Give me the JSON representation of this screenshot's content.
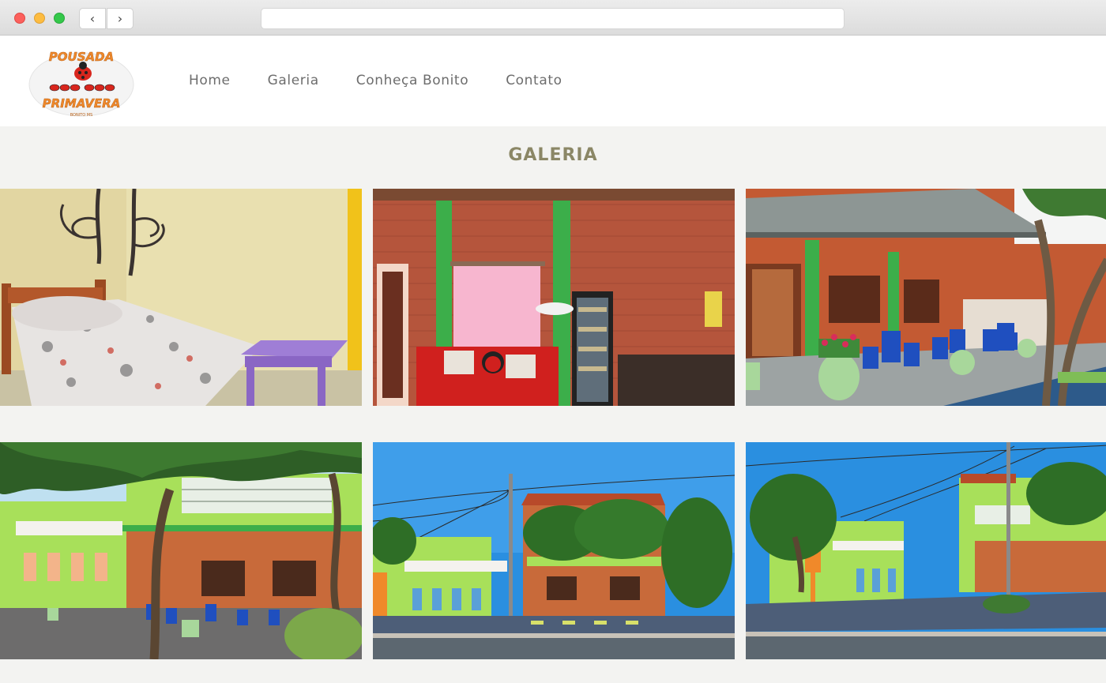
{
  "nav": {
    "back_glyph": "‹",
    "forward_glyph": "›"
  },
  "logo": {
    "line1": "POUSADA",
    "line2": "PRIMAVERA",
    "line3": "BONITO MS"
  },
  "menu": [
    {
      "label": "Home"
    },
    {
      "label": "Galeria"
    },
    {
      "label": "Conheça Bonito"
    },
    {
      "label": "Contato"
    }
  ],
  "gallery": {
    "title": "GALERIA",
    "photos": [
      {
        "subject": "bedroom-with-tree-mural"
      },
      {
        "subject": "lobby-red-sofa-brick-wall"
      },
      {
        "subject": "veranda-blue-tables"
      },
      {
        "subject": "facade-under-trees"
      },
      {
        "subject": "street-view-pousada"
      },
      {
        "subject": "street-corner-pousada"
      }
    ]
  },
  "colors": {
    "brand_orange": "#f0892a",
    "brand_red": "#d8261d",
    "text_gray": "#6d6d6d",
    "title_olive": "#8b8766",
    "page_bg": "#f3f3f1"
  }
}
